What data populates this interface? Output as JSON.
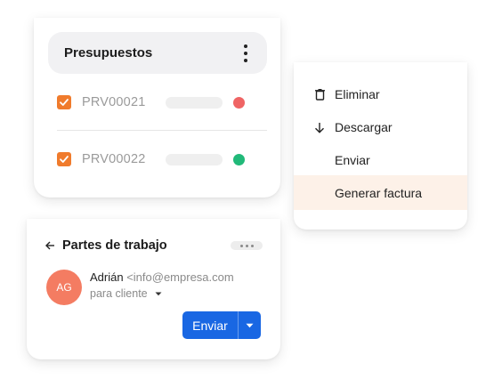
{
  "presupuestos": {
    "title": "Presupuestos",
    "more_icon": "kebab-vertical-icon",
    "rows": [
      {
        "code": "PRV00021",
        "checked": true,
        "status_color": "#ef6464"
      },
      {
        "code": "PRV00022",
        "checked": true,
        "status_color": "#21b979"
      }
    ]
  },
  "context_menu": {
    "items": [
      {
        "label": "Eliminar",
        "icon": "trash-icon"
      },
      {
        "label": "Descargar",
        "icon": "arrow-down-icon"
      },
      {
        "label": "Enviar",
        "icon": ""
      },
      {
        "label": "Generar factura",
        "icon": "",
        "highlighted": true
      }
    ]
  },
  "partes": {
    "title": "Partes de trabajo",
    "back_icon": "arrow-left-icon",
    "more_icon": "more-horizontal-icon",
    "avatar_initials": "AG",
    "sender_name": "Adrián",
    "sender_email": "<info@empresa.com",
    "recipient_label": "para cliente",
    "send_label": "Enviar"
  },
  "colors": {
    "accent_orange": "#f07b2c",
    "primary_blue": "#1967e3",
    "avatar_bg": "#f47c62",
    "highlight_bg": "#fdf1e8"
  }
}
